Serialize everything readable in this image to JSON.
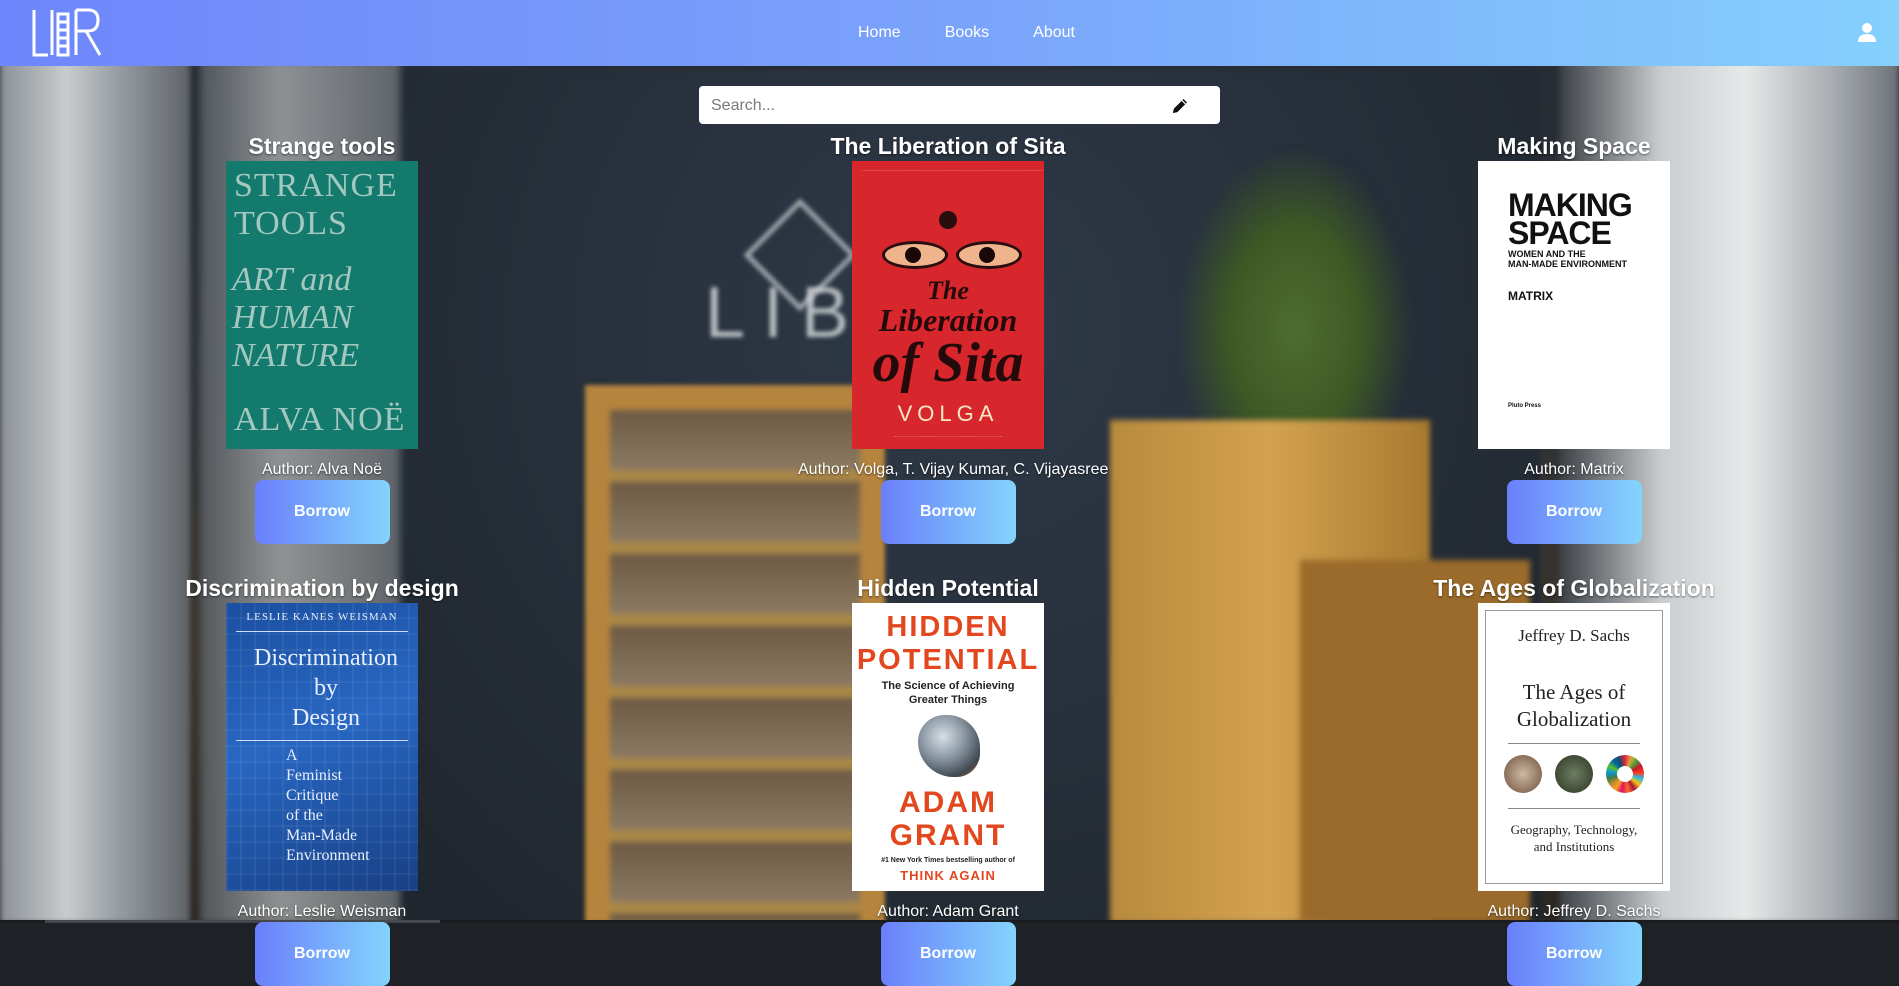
{
  "header": {
    "logo_text": "LIBR",
    "nav": [
      {
        "label": "Home"
      },
      {
        "label": "Books"
      },
      {
        "label": "About"
      }
    ]
  },
  "search": {
    "placeholder": "Search...",
    "value": ""
  },
  "books": [
    {
      "title": "Strange tools",
      "author_label": "Author: Alva Noë",
      "borrow_label": "Borrow",
      "cover": {
        "line1": "STRANGE",
        "line2": "TOOLS",
        "line3": "ART and",
        "line4": "HUMAN",
        "line5": "NATURE",
        "line6": "ALVA NOË",
        "color": "#137a6d"
      }
    },
    {
      "title": "The Liberation of Sita",
      "author_label": "Author: Volga, T. Vijay Kumar, C. Vijayasree",
      "borrow_label": "Borrow",
      "cover": {
        "line1": "The",
        "line2": "Liberation",
        "line3": "of Sita",
        "line4": "VOLGA",
        "color": "#d7272c"
      }
    },
    {
      "title": "Making Space",
      "author_label": "Author: Matrix",
      "borrow_label": "Borrow",
      "cover": {
        "line1": "MAKING",
        "line2": "SPACE",
        "line3": "WOMEN AND THE",
        "line4": "MAN-MADE ENVIRONMENT",
        "line5": "MATRIX",
        "line6": "Pluto Press",
        "color": "#ffffff"
      }
    },
    {
      "title": "Discrimination by design",
      "author_label": "Author: Leslie Weisman",
      "borrow_label": "Borrow",
      "cover": {
        "line0": "LESLIE KANES WEISMAN",
        "line1": "Discrimination",
        "line2": "by",
        "line3": "Design",
        "line4": "A",
        "line5": "Feminist",
        "line6": "Critique",
        "line7": "of the",
        "line8": "Man-Made",
        "line9": "Environment",
        "color": "#1f5bb0"
      }
    },
    {
      "title": "Hidden Potential",
      "author_label": "Author: Adam Grant",
      "borrow_label": "Borrow",
      "cover": {
        "line1": "HIDDEN",
        "line2": "POTENTIAL",
        "line3": "The Science of Achieving",
        "line4": "Greater Things",
        "line5": "ADAM",
        "line6": "GRANT",
        "line7": "#1 New York Times bestselling author of",
        "line8": "THINK AGAIN",
        "color": "#e2471e"
      }
    },
    {
      "title": "The Ages of Globalization",
      "author_label": "Author: Jeffrey D. Sachs",
      "borrow_label": "Borrow",
      "cover": {
        "line1": "Jeffrey D. Sachs",
        "line2": "The Ages of",
        "line3": "Globalization",
        "line4": "Geography, Technology,",
        "line5": "and Institutions",
        "color": "#ffffff"
      }
    }
  ],
  "icons": {
    "user": "user-icon",
    "edit": "pencil-icon"
  },
  "colors": {
    "header_gradient_start": "#6e86fb",
    "header_gradient_end": "#85d0fd",
    "button_gradient_start": "#6a7ffb",
    "button_gradient_end": "#83d4fd"
  }
}
